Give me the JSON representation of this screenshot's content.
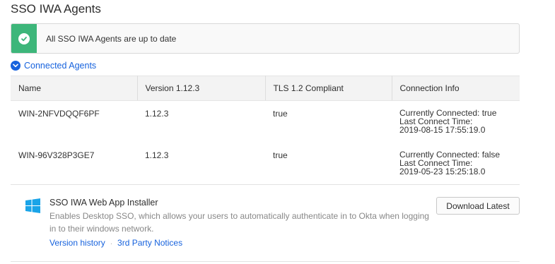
{
  "page": {
    "title": "SSO IWA Agents"
  },
  "alert": {
    "message": "All SSO IWA Agents are up to date",
    "icon": "check-circle-icon",
    "accent_color": "#3db67a"
  },
  "connected_agents": {
    "toggle_label": "Connected Agents",
    "icon": "chevron-down-circle-icon",
    "columns": [
      "Name",
      "Version 1.12.3",
      "TLS 1.2 Compliant",
      "Connection Info"
    ],
    "rows": [
      {
        "name": "WIN-2NFVDQQF6PF",
        "version": "1.12.3",
        "tls": "true",
        "connection": [
          "Currently Connected: true",
          "Last Connect Time:",
          "2019-08-15 17:55:19.0"
        ]
      },
      {
        "name": "WIN-96V328P3GE7",
        "version": "1.12.3",
        "tls": "true",
        "connection": [
          "Currently Connected: false",
          "Last Connect Time:",
          "2019-05-23 15:25:18.0"
        ]
      }
    ]
  },
  "installer": {
    "icon": "windows-logo-icon",
    "title": "SSO IWA Web App Installer",
    "description": "Enables Desktop SSO, which allows your users to automatically authenticate in to Okta when logging in to their windows network.",
    "download_label": "Download Latest",
    "links": [
      "Version history",
      "3rd Party Notices"
    ],
    "link_separator": "·"
  },
  "colors": {
    "link": "#1662dd",
    "success": "#3db67a",
    "windows": "#1aa4e8"
  }
}
